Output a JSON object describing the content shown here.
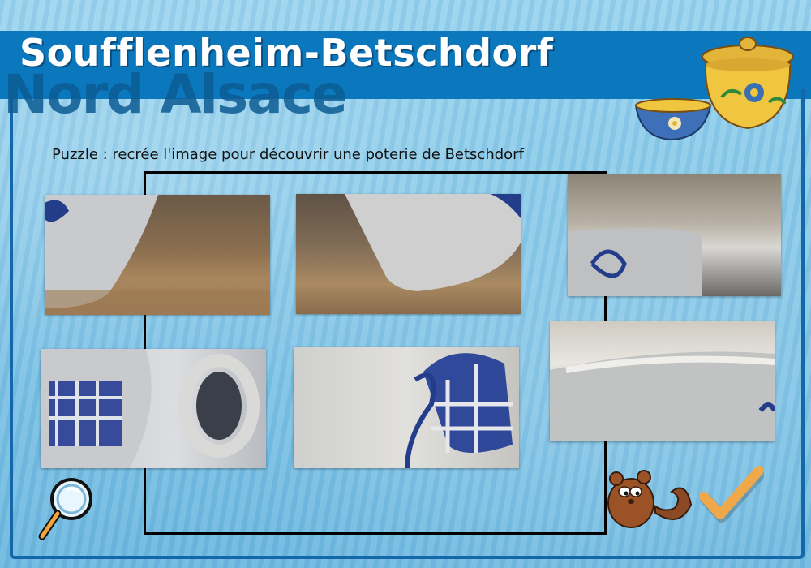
{
  "header": {
    "title": "Soufflenheim-Betschdorf",
    "subtitle": "Nord Alsace"
  },
  "puzzle": {
    "instruction": "Puzzle : recrée l'image pour découvrir une poterie de Betschdorf",
    "piece_count": 6
  },
  "icons": {
    "hint": "magnifier-icon",
    "validate": "checkmark-icon",
    "mascot": "squirrel-mascot",
    "decoration": "pottery-illustration"
  },
  "colors": {
    "banner": "#0b78bd",
    "background": "#8ccbe8",
    "frame": "#1467a8",
    "check": "#f0a94a"
  }
}
